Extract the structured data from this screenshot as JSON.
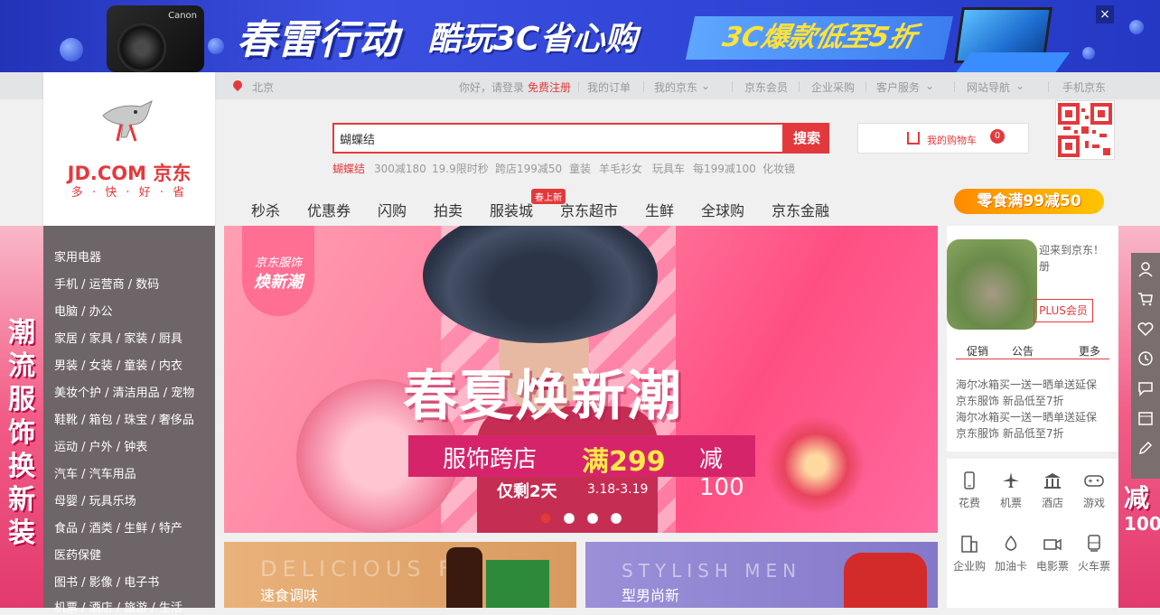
{
  "banner": {
    "title": "春雷行动",
    "subtitle": "酷玩3C省心购",
    "tag": "3C爆款低至5折",
    "camera_brand": "Canon",
    "close": "×"
  },
  "shortcut": {
    "location": "北京",
    "greeting": "你好，请登录",
    "register": "免费注册",
    "orders": "我的订单",
    "myjd": "我的京东",
    "member": "京东会员",
    "enterprise": "企业采购",
    "service": "客户服务",
    "sitenav": "网站导航",
    "mobile": "手机京东",
    "dropdown_glyph": "⌄"
  },
  "logo": {
    "name": "JD.COM 京东",
    "slogan": "多 · 快 · 好 · 省"
  },
  "search": {
    "value": "蝴蝶结",
    "button": "搜索"
  },
  "cart": {
    "label": "我的购物车",
    "count": "0"
  },
  "hotkeys": [
    "蝴蝶结",
    "300减180",
    "19.9限时秒",
    "跨店199减50",
    "童装",
    "羊毛衫女",
    "玩具车",
    "每199减100",
    "化妆镜"
  ],
  "nav": {
    "items": [
      "秒杀",
      "优惠券",
      "闪购",
      "拍卖",
      "服装城",
      "京东超市",
      "生鲜",
      "全球购",
      "京东金融"
    ],
    "badge": "春上新",
    "promo": "零食满99减50"
  },
  "categories": [
    "家用电器",
    "手机 / 运营商 / 数码",
    "电脑 / 办公",
    "家居 / 家具 / 家装 / 厨具",
    "男装 / 女装 / 童装 / 内衣",
    "美妆个护 / 清洁用品 / 宠物",
    "鞋靴 / 箱包 / 珠宝 / 奢侈品",
    "运动 / 户外 / 钟表",
    "汽车 / 汽车用品",
    "母婴 / 玩具乐场",
    "食品 / 酒类 / 生鲜 / 特产",
    "医药保健",
    "图书 / 影像 / 电子书",
    "机票 / 酒店 / 旅游 / 生活"
  ],
  "left_deco": "潮流服饰换新装",
  "right_deco": {
    "text": "减",
    "num": "100"
  },
  "slider": {
    "badge_top": "京东服饰",
    "badge_bottom": "焕新潮",
    "title": "春夏焕新潮",
    "promo_a": "服饰跨店",
    "promo_b": "满299",
    "promo_c": "减100",
    "left": "仅剩2天",
    "date": "3.18-3.19",
    "active_index": 0,
    "dots": 4
  },
  "promo1": {
    "en": "DELICIOUS F",
    "zh": "速食调味"
  },
  "promo2": {
    "en": "STYLISH MEN",
    "zh": "型男尚新"
  },
  "user": {
    "hello": "迎来到京东！",
    "register": "册",
    "plus": "PLUS会员",
    "tab1": "促销",
    "tab2": "公告",
    "more": "更多",
    "news": [
      "海尔冰箱买一送一晒单送延保",
      "京东服饰 新品低至7折",
      "海尔冰箱买一送一晒单送延保",
      "京东服饰 新品低至7折"
    ]
  },
  "services": [
    "花费",
    "机票",
    "酒店",
    "游戏",
    "企业购",
    "加油卡",
    "电影票",
    "火车票"
  ],
  "colors": {
    "accent": "#e4393c",
    "category_bg": "#6e6568"
  }
}
